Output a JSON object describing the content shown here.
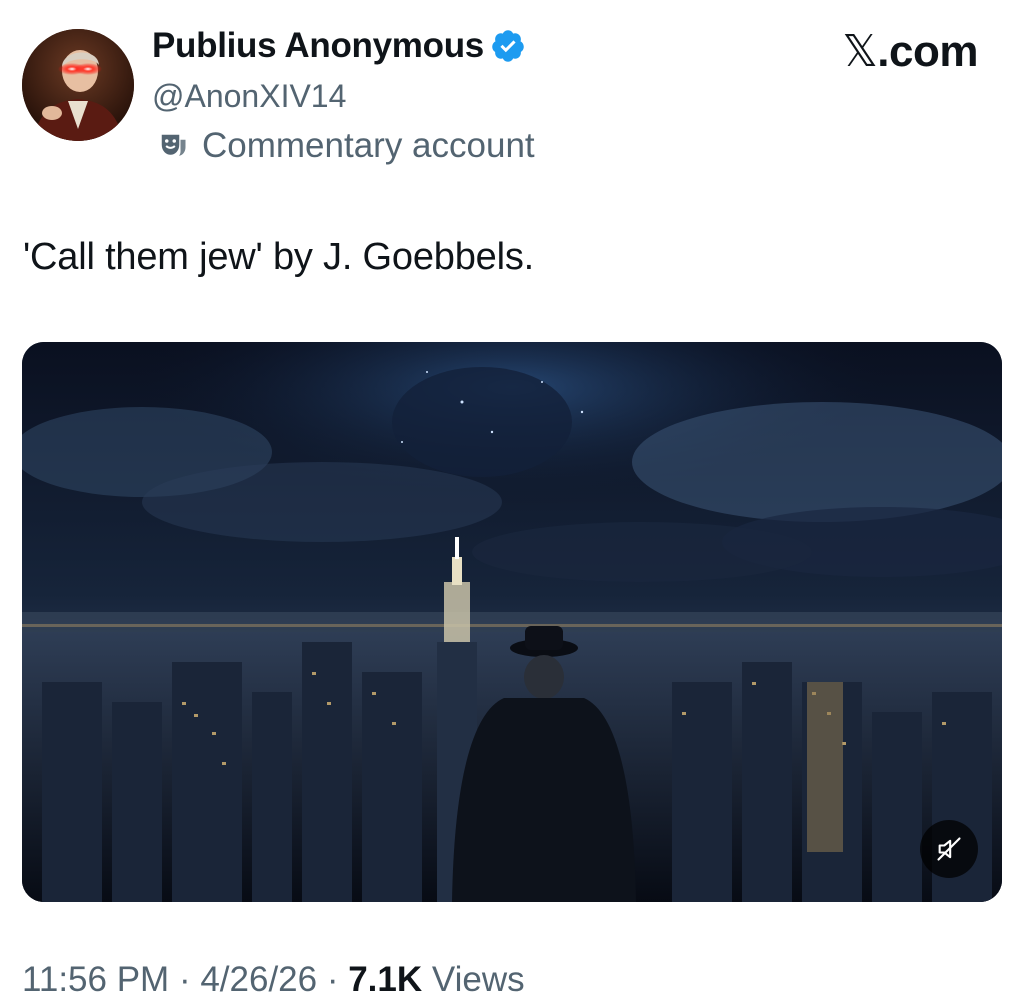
{
  "author": {
    "display_name": "Publius Anonymous",
    "handle": "@AnonXIV14",
    "account_label": "Commentary account",
    "verified_color": "#1d9bf0"
  },
  "brand": {
    "logo_text": ".com",
    "logo_glyph": "𝕏"
  },
  "tweet": {
    "text": "'Call them jew' by J. Goebbels."
  },
  "media": {
    "type": "video",
    "muted": true,
    "mute_icon": "speaker-muted-icon"
  },
  "meta": {
    "time": "11:56 PM",
    "sep1": " · ",
    "date": "4/26/26",
    "sep2": " · ",
    "views_count": "7.1K",
    "views_label": " Views"
  },
  "colors": {
    "text_primary": "#0f1419",
    "text_secondary": "#536471",
    "verified_blue": "#1d9bf0"
  }
}
